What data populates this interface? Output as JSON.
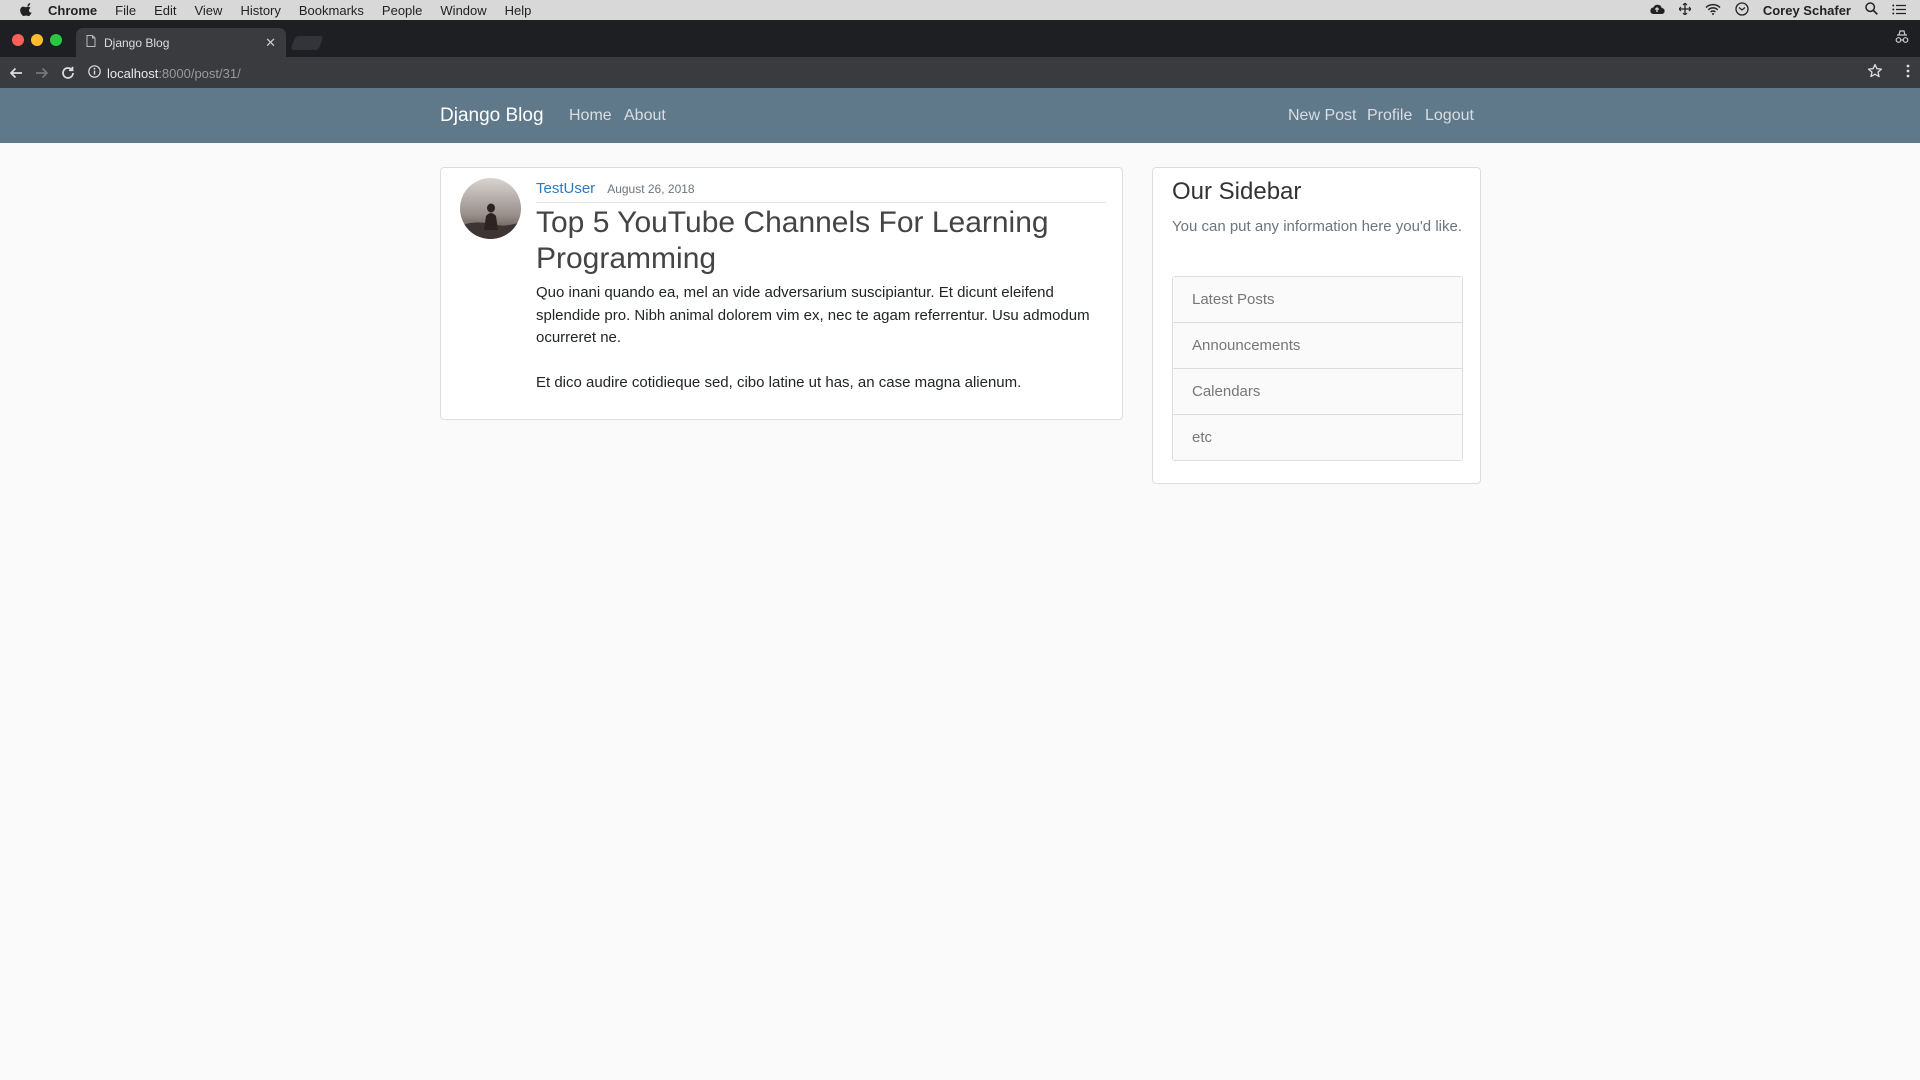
{
  "menubar": {
    "items": [
      "Chrome",
      "File",
      "Edit",
      "View",
      "History",
      "Bookmarks",
      "People",
      "Window",
      "Help"
    ],
    "user": "Corey Schafer"
  },
  "browser": {
    "tab_title": "Django Blog",
    "url_host": "localhost",
    "url_rest": ":8000/post/31/"
  },
  "site": {
    "brand": "Django Blog",
    "nav_left": [
      "Home",
      "About"
    ],
    "nav_right": [
      "New Post",
      "Profile",
      "Logout"
    ]
  },
  "post": {
    "author": "TestUser",
    "date": "August 26, 2018",
    "title": "Top 5 YouTube Channels For Learning Programming",
    "paragraphs": [
      "Quo inani quando ea, mel an vide adversarium suscipiantur. Et dicunt eleifend splendide pro. Nibh animal dolorem vim ex, nec te agam referrentur. Usu admodum ocurreret ne.",
      "Et dico audire cotidieque sed, cibo latine ut has, an case magna alienum."
    ]
  },
  "sidebar": {
    "title": "Our Sidebar",
    "description": "You can put any information here you'd like.",
    "items": [
      "Latest Posts",
      "Announcements",
      "Calendars",
      "etc"
    ]
  }
}
